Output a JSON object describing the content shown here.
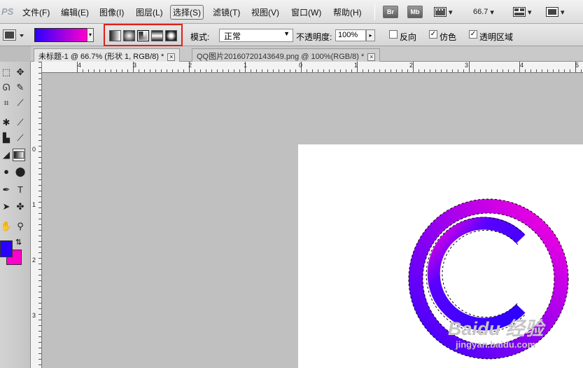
{
  "app": {
    "logo": "PS"
  },
  "menu": {
    "items": [
      "文件(F)",
      "编辑(E)",
      "图像(I)",
      "图层(L)",
      "选择(S)",
      "滤镜(T)",
      "视图(V)",
      "窗口(W)",
      "帮助(H)"
    ],
    "active_index": 4
  },
  "app_bar": {
    "bridge": "Br",
    "mini_bridge": "Mb",
    "zoom": "66.7"
  },
  "options": {
    "gradient_colors": [
      "#2a00ff",
      "#ff00cc"
    ],
    "gradient_types": [
      "linear-gradient-icon",
      "radial-gradient-icon",
      "angle-gradient-icon",
      "reflected-gradient-icon",
      "diamond-gradient-icon"
    ],
    "selected_type_index": 2,
    "mode_label": "模式:",
    "mode_value": "正常",
    "opacity_label": "不透明度:",
    "opacity_value": "100%",
    "reverse_label": "反向",
    "reverse_checked": false,
    "dither_label": "仿色",
    "dither_checked": true,
    "transparency_label": "透明区域",
    "transparency_checked": true
  },
  "tabs": [
    {
      "label": "未标题-1 @ 66.7% (形状 1, RGB/8) *",
      "active": true
    },
    {
      "label": "QQ图片20160720143649.png @ 100%(RGB/8) *",
      "active": false
    }
  ],
  "rulers": {
    "top_labels": [
      "4",
      "3",
      "2",
      "1",
      "0",
      "1",
      "2",
      "3",
      "4",
      "5"
    ],
    "left_labels": [
      "0",
      "1",
      "2",
      "3"
    ]
  },
  "tools": {
    "foreground_color": "#2a00ff",
    "background_color": "#ff00cc"
  },
  "watermark": {
    "text": "Baidu 经验",
    "url": "jingyan.baidu.com"
  }
}
